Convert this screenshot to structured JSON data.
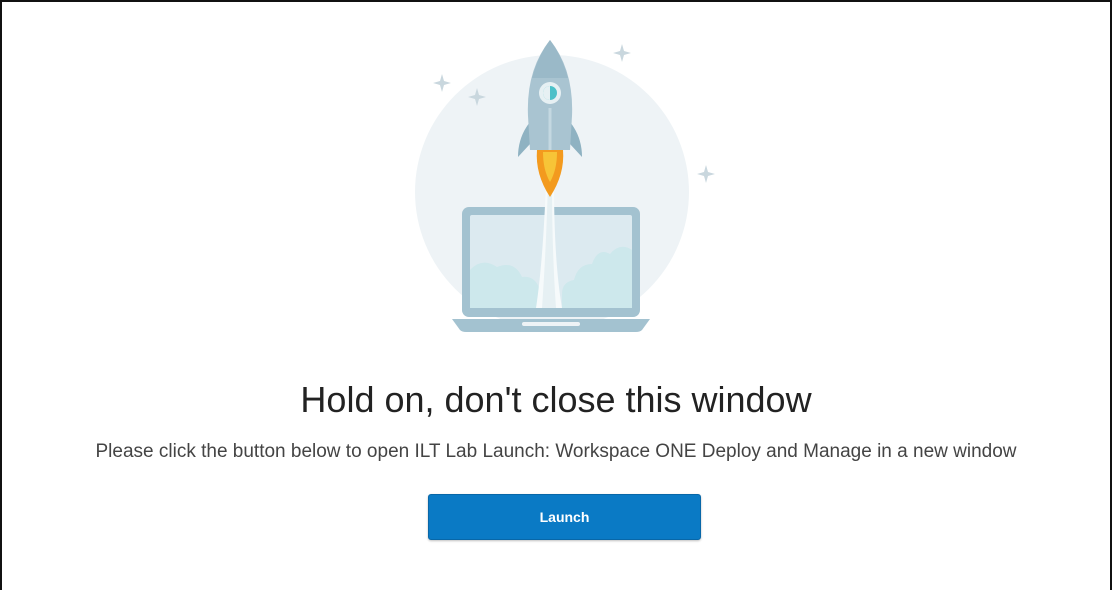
{
  "page": {
    "heading": "Hold on, don't close this window",
    "message": "Please click the button below to open ILT Lab Launch: Workspace ONE Deploy and Manage in a new window",
    "launch_label": "Launch"
  },
  "illustration": {
    "icon": "rocket-launch-from-laptop",
    "colors": {
      "circle": "#eef3f6",
      "laptop": "#a3c2d0",
      "screen": "#dceaf0",
      "rocket": "#a9c4d1",
      "window": "#4cc0c8",
      "flame_outer": "#f39a1e",
      "flame_inner": "#f7c437",
      "cloud": "#cde8ec",
      "sparkle": "#c9d7de"
    }
  },
  "colors": {
    "button": "#0a7ac5",
    "heading_text": "#222222",
    "message_text": "#444444"
  }
}
